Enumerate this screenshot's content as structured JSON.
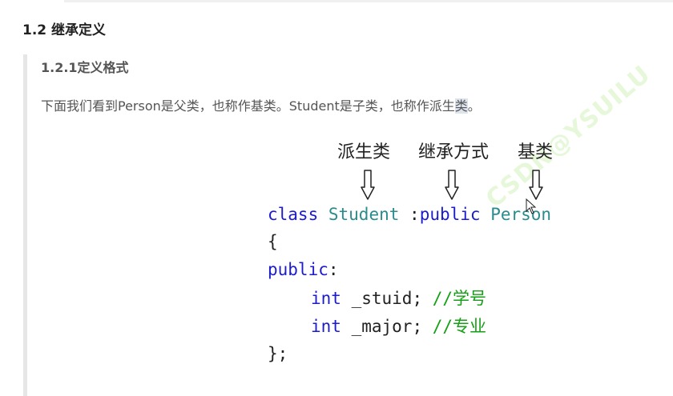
{
  "heading_section": "1.2 继承定义",
  "heading_subsection": "1.2.1定义格式",
  "paragraph": {
    "text_before": "下面我们看到Person是父类，也称作基类。Student是子类，也称作派生",
    "text_highlight": "类",
    "text_after": "。"
  },
  "annotations": {
    "derived": "派生类",
    "inherit_mode": "继承方式",
    "base": "基类"
  },
  "code": {
    "line1": {
      "kw_class": "class",
      "class_name": "Student",
      "colon": " :",
      "kw_access": "public",
      "base_name": "Person"
    },
    "line2": "{",
    "line3": {
      "kw_public": "public",
      "colon": ":"
    },
    "line4": {
      "type": "int",
      "name": " _stuid; ",
      "comment": "//学号"
    },
    "line5": {
      "type": "int",
      "name": " _major; ",
      "comment": "//专业"
    },
    "line6": "};"
  },
  "watermark": "CSDN@YSUILU",
  "colors": {
    "keyword": "#1c1ccc",
    "class_name": "#2a8c8c",
    "comment": "#14a014",
    "highlight": "#dde4ee"
  }
}
